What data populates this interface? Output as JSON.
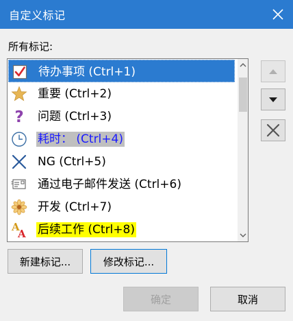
{
  "window": {
    "title": "自定义标记"
  },
  "list_label": "所有标记:",
  "items": [
    {
      "label": "待办事项 (Ctrl+1)",
      "icon": "checkbox-icon"
    },
    {
      "label": "重要 (Ctrl+2)",
      "icon": "star-icon"
    },
    {
      "label": "问题 (Ctrl+3)",
      "icon": "question-mark-icon"
    },
    {
      "label": "耗时： (Ctrl+4)",
      "icon": "clock-icon"
    },
    {
      "label": "NG (Ctrl+5)",
      "icon": "x-mark-icon"
    },
    {
      "label": "通过电子邮件发送 (Ctrl+6)",
      "icon": "email-icon"
    },
    {
      "label": "开发 (Ctrl+7)",
      "icon": "flower-icon"
    },
    {
      "label": "后续工作 (Ctrl+8)",
      "icon": "font-color-icon"
    }
  ],
  "buttons": {
    "new": "新建标记...",
    "modify": "修改标记...",
    "ok": "确定",
    "cancel": "取消"
  },
  "colors": {
    "titlebar": "#2b7bd0",
    "selection": "#2b7bd0",
    "highlight_gray": "#bfbfbf",
    "highlight_yellow": "#ffff00"
  }
}
